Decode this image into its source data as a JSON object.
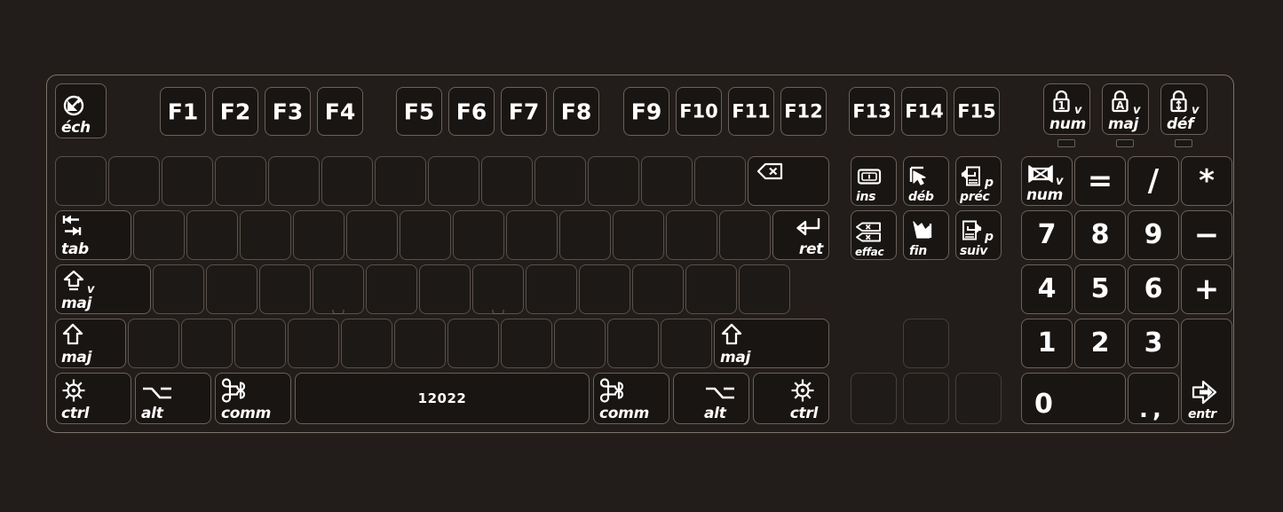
{
  "meta": {
    "device": "keyboard-sticker-layout",
    "language": "fr",
    "product_code": "12022"
  },
  "colors": {
    "background": "#221d1a",
    "key_face": "#191512",
    "key_border": "#6a615b",
    "legend": "#ffffff",
    "bezel": "#7d736c"
  },
  "function_row": {
    "escape": {
      "label": "éch",
      "icon": "escape-circle-arrow-icon"
    },
    "group1": [
      "F1",
      "F2",
      "F3",
      "F4"
    ],
    "group2": [
      "F5",
      "F6",
      "F7",
      "F8"
    ],
    "group3": [
      "F9",
      "F10",
      "F11",
      "F12"
    ],
    "group4": [
      "F13",
      "F14",
      "F15"
    ],
    "locks": [
      {
        "label": "num",
        "sup": "v",
        "icon": "padlock-num-icon",
        "glyph": "1"
      },
      {
        "label": "maj",
        "sup": "v",
        "icon": "padlock-caps-icon",
        "glyph": "A"
      },
      {
        "label": "déf",
        "sup": "v",
        "icon": "padlock-scroll-icon",
        "glyph": "updown"
      }
    ]
  },
  "main_block": {
    "number_row_blank_keys": 13,
    "backspace": {
      "label": "",
      "icon": "backspace-delete-icon"
    },
    "tab": {
      "label": "tab",
      "icon": "tab-arrows-icon"
    },
    "tab_row_blank_keys": 12,
    "return": {
      "label": "ret",
      "icon": "return-arrow-icon"
    },
    "caps_lock": {
      "label": "maj",
      "sup": "v",
      "icon": "caps-lock-arrow-icon"
    },
    "home_row_blank_keys": 12,
    "shift_left": {
      "label": "maj",
      "icon": "shift-arrow-icon"
    },
    "shift_right": {
      "label": "maj",
      "icon": "shift-arrow-icon"
    },
    "bottom_letter_row_blank_keys": 11,
    "control_left": {
      "label": "ctrl",
      "icon": "control-wheel-icon"
    },
    "option_left": {
      "label": "alt",
      "icon": "option-alt-icon"
    },
    "command_left": {
      "label": "comm",
      "icon": "command-icon"
    },
    "spacebar": {
      "label": "12022"
    },
    "command_right": {
      "label": "comm",
      "icon": "command-icon"
    },
    "option_right": {
      "label": "alt",
      "icon": "option-alt-icon"
    },
    "control_right": {
      "label": "ctrl",
      "icon": "control-wheel-icon"
    }
  },
  "navigation_block": [
    {
      "label": "ins",
      "icon": "insert-box-icon"
    },
    {
      "label": "déb",
      "icon": "home-arrow-icon"
    },
    {
      "label": "préc",
      "sup": "p",
      "icon": "page-up-icon"
    },
    {
      "label": "effac",
      "icon": "forward-delete-icon"
    },
    {
      "label": "fin",
      "icon": "end-arrow-icon"
    },
    {
      "label": "suiv",
      "sup": "p",
      "icon": "page-down-icon"
    }
  ],
  "arrow_cluster": {
    "up": "",
    "left": "",
    "down": "",
    "right": ""
  },
  "numpad": {
    "row0": [
      {
        "label": "num",
        "sup": "v",
        "icon": "clear-numlock-icon"
      },
      {
        "label": "="
      },
      {
        "label": "/"
      },
      {
        "label": "*"
      }
    ],
    "row1": [
      {
        "label": "7"
      },
      {
        "label": "8"
      },
      {
        "label": "9"
      },
      {
        "label": "−"
      }
    ],
    "row2": [
      {
        "label": "4"
      },
      {
        "label": "5"
      },
      {
        "label": "6"
      },
      {
        "label": "+"
      }
    ],
    "row3": [
      {
        "label": "1"
      },
      {
        "label": "2"
      },
      {
        "label": "3"
      }
    ],
    "row4": [
      {
        "label": "0"
      },
      {
        "label_top": ".",
        "label_bottom": ","
      }
    ],
    "enter": {
      "label": "entr",
      "icon": "enter-arrow-icon"
    }
  }
}
